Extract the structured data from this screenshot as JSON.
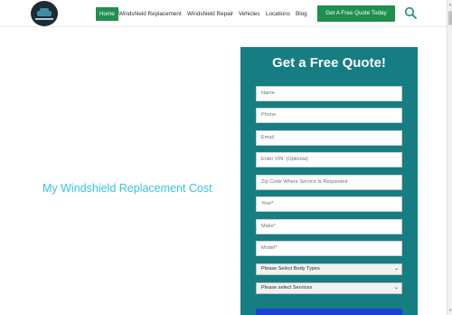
{
  "header": {
    "logo_icon": "car-logo-icon",
    "nav": [
      {
        "label": "Home",
        "active": true
      },
      {
        "label": "Windshield Replacement",
        "active": false
      },
      {
        "label": "Windshield Repair",
        "active": false
      },
      {
        "label": "Vehicles",
        "active": false
      },
      {
        "label": "Locations",
        "active": false
      },
      {
        "label": "Blog",
        "active": false
      }
    ],
    "cta_label": "Get A Free Quote Today",
    "search_icon": "search-icon"
  },
  "hero": {
    "title": "My Windshield Replacement Cost"
  },
  "quote_form": {
    "title": "Get a Free Quote!",
    "fields": [
      {
        "placeholder": "Name"
      },
      {
        "placeholder": "Phone"
      },
      {
        "placeholder": "Email"
      },
      {
        "placeholder": "Enter VIN: (Optional)"
      },
      {
        "placeholder": "Zip Code Where Service Is Requested"
      },
      {
        "placeholder": "Year*"
      },
      {
        "placeholder": "Make*"
      },
      {
        "placeholder": "Model*"
      }
    ],
    "selects": [
      {
        "value": "Please Select Body Types"
      },
      {
        "value": "Please select Services"
      }
    ]
  },
  "colors": {
    "brand_green": "#1f8f50",
    "panel_teal": "#167d82",
    "hero_text": "#39c3e0",
    "submit_blue": "#1b42d4"
  }
}
